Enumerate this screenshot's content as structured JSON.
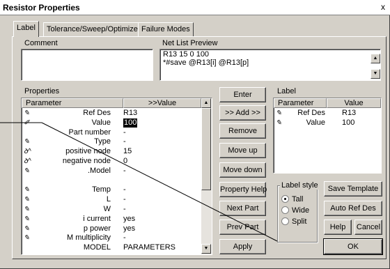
{
  "window": {
    "title": "Resistor Properties",
    "close_glyph": "x"
  },
  "tabs": [
    "Label",
    "Tolerance/Sweep/Optimize",
    "Failure Modes"
  ],
  "comment": {
    "label": "Comment",
    "value": ""
  },
  "netlist": {
    "label": "Net List Preview",
    "lines": [
      "R13 15 0 100",
      "*#save  @R13[i] @R13[p]"
    ]
  },
  "properties": {
    "label": "Properties",
    "col_parameter": "Parameter",
    "col_value": ">>Value",
    "rows": [
      {
        "icon": "pencil-icon",
        "glyph": "✎",
        "name": "Ref Des",
        "value": "R13",
        "selected": false
      },
      {
        "icon": "pencil-filled-icon",
        "glyph": "✐",
        "name": "Value",
        "value": "100",
        "selected": true
      },
      {
        "icon": "",
        "glyph": "",
        "name": "Part number",
        "value": "-",
        "selected": false
      },
      {
        "icon": "pencil-icon",
        "glyph": "✎",
        "name": "Type",
        "value": "-",
        "selected": false
      },
      {
        "icon": "node-icon",
        "glyph": "ꝺ^",
        "name": "positive node",
        "value": "15",
        "selected": false
      },
      {
        "icon": "node-icon",
        "glyph": "ꝺ^",
        "name": "negative node",
        "value": "0",
        "selected": false
      },
      {
        "icon": "pencil-icon",
        "glyph": "✎",
        "name": ".Model",
        "value": "-",
        "selected": false
      },
      {
        "icon": "",
        "glyph": "",
        "name": "",
        "value": "",
        "selected": false
      },
      {
        "icon": "pencil-icon",
        "glyph": "✎",
        "name": "Temp",
        "value": "-",
        "selected": false
      },
      {
        "icon": "pencil-icon",
        "glyph": "✎",
        "name": "L",
        "value": "-",
        "selected": false
      },
      {
        "icon": "pencil-icon",
        "glyph": "✎",
        "name": "W",
        "value": "-",
        "selected": false
      },
      {
        "icon": "pencil-icon",
        "glyph": "✎",
        "name": "i current",
        "value": "yes",
        "selected": false
      },
      {
        "icon": "pencil-icon",
        "glyph": "✎",
        "name": "p power",
        "value": "yes",
        "selected": false
      },
      {
        "icon": "pencil-icon",
        "glyph": "✎",
        "name": "M multiplicity",
        "value": "-",
        "selected": false
      },
      {
        "icon": "",
        "glyph": "",
        "name": "MODEL",
        "value": "PARAMETERS",
        "selected": false
      }
    ]
  },
  "buttons": {
    "enter": "Enter",
    "add": ">> Add >>",
    "remove": "Remove",
    "move_up": "Move up",
    "move_down": "Move down",
    "property_help": "Property Help",
    "next_part": "Next Part",
    "prev_part": "Prev Part",
    "apply": "Apply",
    "save_template": "Save Template",
    "auto_ref_des": "Auto Ref Des",
    "help": "Help",
    "cancel": "Cancel",
    "ok": "OK"
  },
  "label_panel": {
    "label": "Label",
    "col_parameter": "Parameter",
    "col_value": "Value",
    "rows": [
      {
        "icon": "pencil-icon",
        "glyph": "✎",
        "name": "Ref Des",
        "value": "R13"
      },
      {
        "icon": "pencil-icon",
        "glyph": "✎",
        "name": "Value",
        "value": "100"
      }
    ]
  },
  "label_style": {
    "label": "Label style",
    "options": [
      {
        "label": "Tall",
        "selected": true
      },
      {
        "label": "Wide",
        "selected": false
      },
      {
        "label": "Split",
        "selected": false
      }
    ]
  },
  "colors": {
    "dialog_bg": "#d4d0c8",
    "selection": "#000000"
  }
}
